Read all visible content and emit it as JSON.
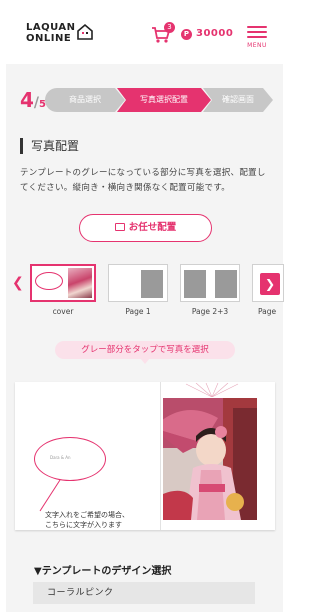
{
  "header": {
    "logo_line1": "LAQUAN",
    "logo_line2": "ONLINE",
    "cart_count": "3",
    "points_symbol": "P",
    "points_value": "30000",
    "menu_label": "MENU"
  },
  "steps": {
    "current": "4",
    "total": "5",
    "items": [
      "商品選択",
      "写真選択配置",
      "確認画面"
    ]
  },
  "section": {
    "title": "写真配置",
    "description": "テンプレートのグレーになっている部分に写真を選択、配置してください。縦向き・横向き関係なく配置可能です。"
  },
  "auto_button": {
    "label": "お任せ配置"
  },
  "pages": [
    {
      "label": "cover"
    },
    {
      "label": "Page 1"
    },
    {
      "label": "Page 2+3"
    },
    {
      "label": "Page"
    }
  ],
  "tip": {
    "text": "グレー部分をタップで写真を選択"
  },
  "spread": {
    "balloon_text": "Dara & An",
    "hint_line1": "文字入れをご希望の場合、",
    "hint_line2": "こちらに文字が入ります"
  },
  "design": {
    "label": "▼テンプレートのデザイン選択",
    "selected": "コーラルピンク"
  },
  "colors": {
    "accent": "#e5336f",
    "inactive_step": "#c7c7c7",
    "gray_slot": "#9a9a9a"
  }
}
